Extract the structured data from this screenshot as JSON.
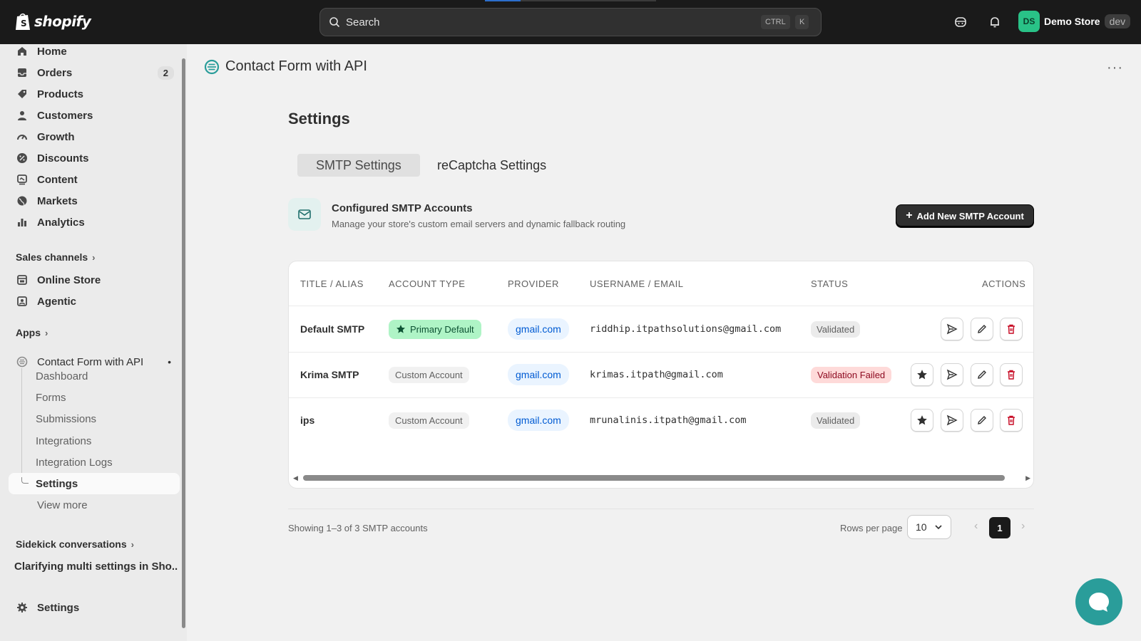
{
  "topbar": {
    "brand": "shopify",
    "search_placeholder": "Search",
    "kbd_ctrl": "CTRL",
    "kbd_k": "K",
    "store_initials": "DS",
    "store_name": "Demo Store",
    "store_env": "dev"
  },
  "sidebar": {
    "items": [
      {
        "label": "Home",
        "icon": "home-icon"
      },
      {
        "label": "Orders",
        "icon": "inbox-icon",
        "badge": "2"
      },
      {
        "label": "Products",
        "icon": "tag-icon"
      },
      {
        "label": "Customers",
        "icon": "person-icon"
      },
      {
        "label": "Growth",
        "icon": "gauge-icon"
      },
      {
        "label": "Discounts",
        "icon": "discount-icon"
      },
      {
        "label": "Content",
        "icon": "content-icon"
      },
      {
        "label": "Markets",
        "icon": "globe-icon"
      },
      {
        "label": "Analytics",
        "icon": "bar-chart-icon"
      }
    ],
    "sales_channels_label": "Sales channels",
    "channels": [
      {
        "label": "Online Store",
        "icon": "store-icon"
      },
      {
        "label": "Agentic",
        "icon": "agentic-icon"
      }
    ],
    "apps_label": "Apps",
    "app_name": "Contact Form with API",
    "app_subitems": [
      "Dashboard",
      "Forms",
      "Submissions",
      "Integrations",
      "Integration Logs",
      "Settings"
    ],
    "view_more": "View more",
    "sidekick_label": "Sidekick conversations",
    "sidekick_conversation": "Clarifying multi settings in Sho...",
    "settings_label": "Settings"
  },
  "main": {
    "app_title": "Contact Form with API",
    "page_title": "Settings",
    "tabs": [
      {
        "label": "SMTP Settings",
        "active": true
      },
      {
        "label": "reCaptcha Settings",
        "active": false
      }
    ],
    "section_title": "Configured SMTP Accounts",
    "section_subtitle": "Manage your store's custom email servers and dynamic fallback routing",
    "add_button": "Add New SMTP Account",
    "table": {
      "headers": [
        "TITLE / ALIAS",
        "ACCOUNT TYPE",
        "PROVIDER",
        "USERNAME / EMAIL",
        "STATUS",
        "ACTIONS"
      ],
      "rows": [
        {
          "title": "Default SMTP",
          "type": "Primary Default",
          "provider": "gmail.com",
          "email": "riddhip.itpathsolutions@gmail.com",
          "status": "Validated"
        },
        {
          "title": "Krima SMTP",
          "type": "Custom Account",
          "provider": "gmail.com",
          "email": "krimas.itpath@gmail.com",
          "status": "Validation Failed"
        },
        {
          "title": "ips",
          "type": "Custom Account",
          "provider": "gmail.com",
          "email": "mrunalinis.itpath@gmail.com",
          "status": "Validated"
        }
      ]
    },
    "footer": {
      "showing": "Showing 1–3 of 3 SMTP accounts",
      "rows_per_page_label": "Rows per page",
      "rows_per_page_value": "10",
      "current_page": "1"
    }
  },
  "colors": {
    "topbar_bg": "#1a1a1a",
    "accent_teal": "#2a9d9a",
    "primary_badge_bg": "#aff4c6",
    "fail_badge_bg": "#fedad9",
    "danger_icon": "#c70a24",
    "provider_blue": "#005bd3"
  }
}
